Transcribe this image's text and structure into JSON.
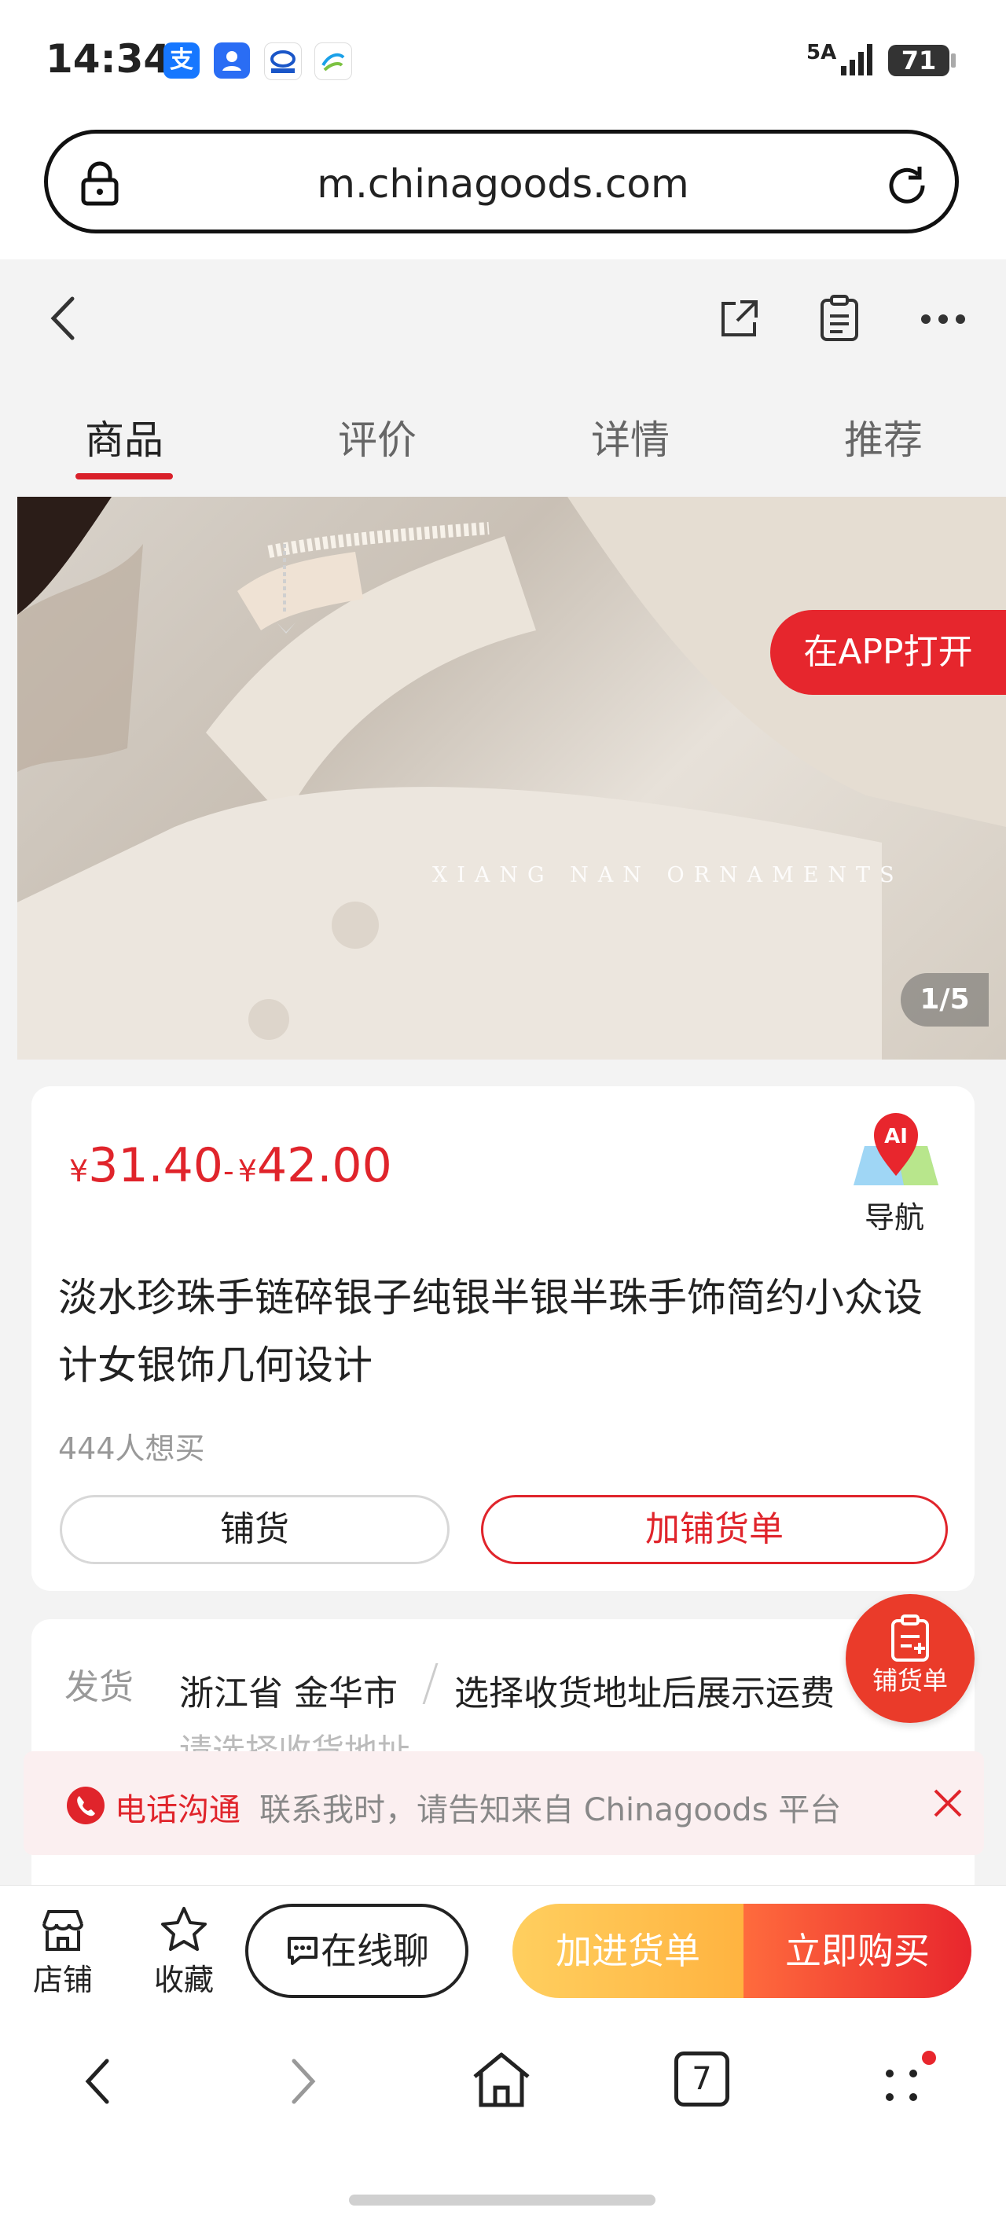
{
  "status_bar": {
    "time": "14:34",
    "network": "5A",
    "battery": "71"
  },
  "browser": {
    "url": "m.chinagoods.com",
    "tab_count": "7"
  },
  "tabs": [
    {
      "label": "商品",
      "active": true
    },
    {
      "label": "评价",
      "active": false
    },
    {
      "label": "详情",
      "active": false
    },
    {
      "label": "推荐",
      "active": false
    }
  ],
  "hero": {
    "open_app": "在APP打开",
    "watermark": "XIANG NAN ORNAMENTS",
    "pager": "1/5"
  },
  "product": {
    "currency": "¥",
    "price_low": "31.40",
    "separator": "-",
    "price_high": "42.00",
    "nav_label": "导航",
    "title": "淡水珍珠手链碎银子纯银半银半珠手饰简约小众设计女银饰几何设计",
    "wanted": "444人想买",
    "btn_stock": "铺货",
    "btn_add_stock_list": "加铺货单"
  },
  "shipping": {
    "label": "发货",
    "location": "浙江省 金华市",
    "note": "选择收货地址后展示运费",
    "address_hint": "请选择收货地址"
  },
  "fab": {
    "label": "铺货单"
  },
  "toast": {
    "title": "电话沟通",
    "text": "联系我时，请告知来自 Chinagoods 平台"
  },
  "actionbar": {
    "shop": "店铺",
    "favorite": "收藏",
    "chat": "在线聊",
    "add_cart": "加进货单",
    "buy_now": "立即购买"
  },
  "colors": {
    "accent": "#e0242b",
    "orange": "#ffb340"
  }
}
